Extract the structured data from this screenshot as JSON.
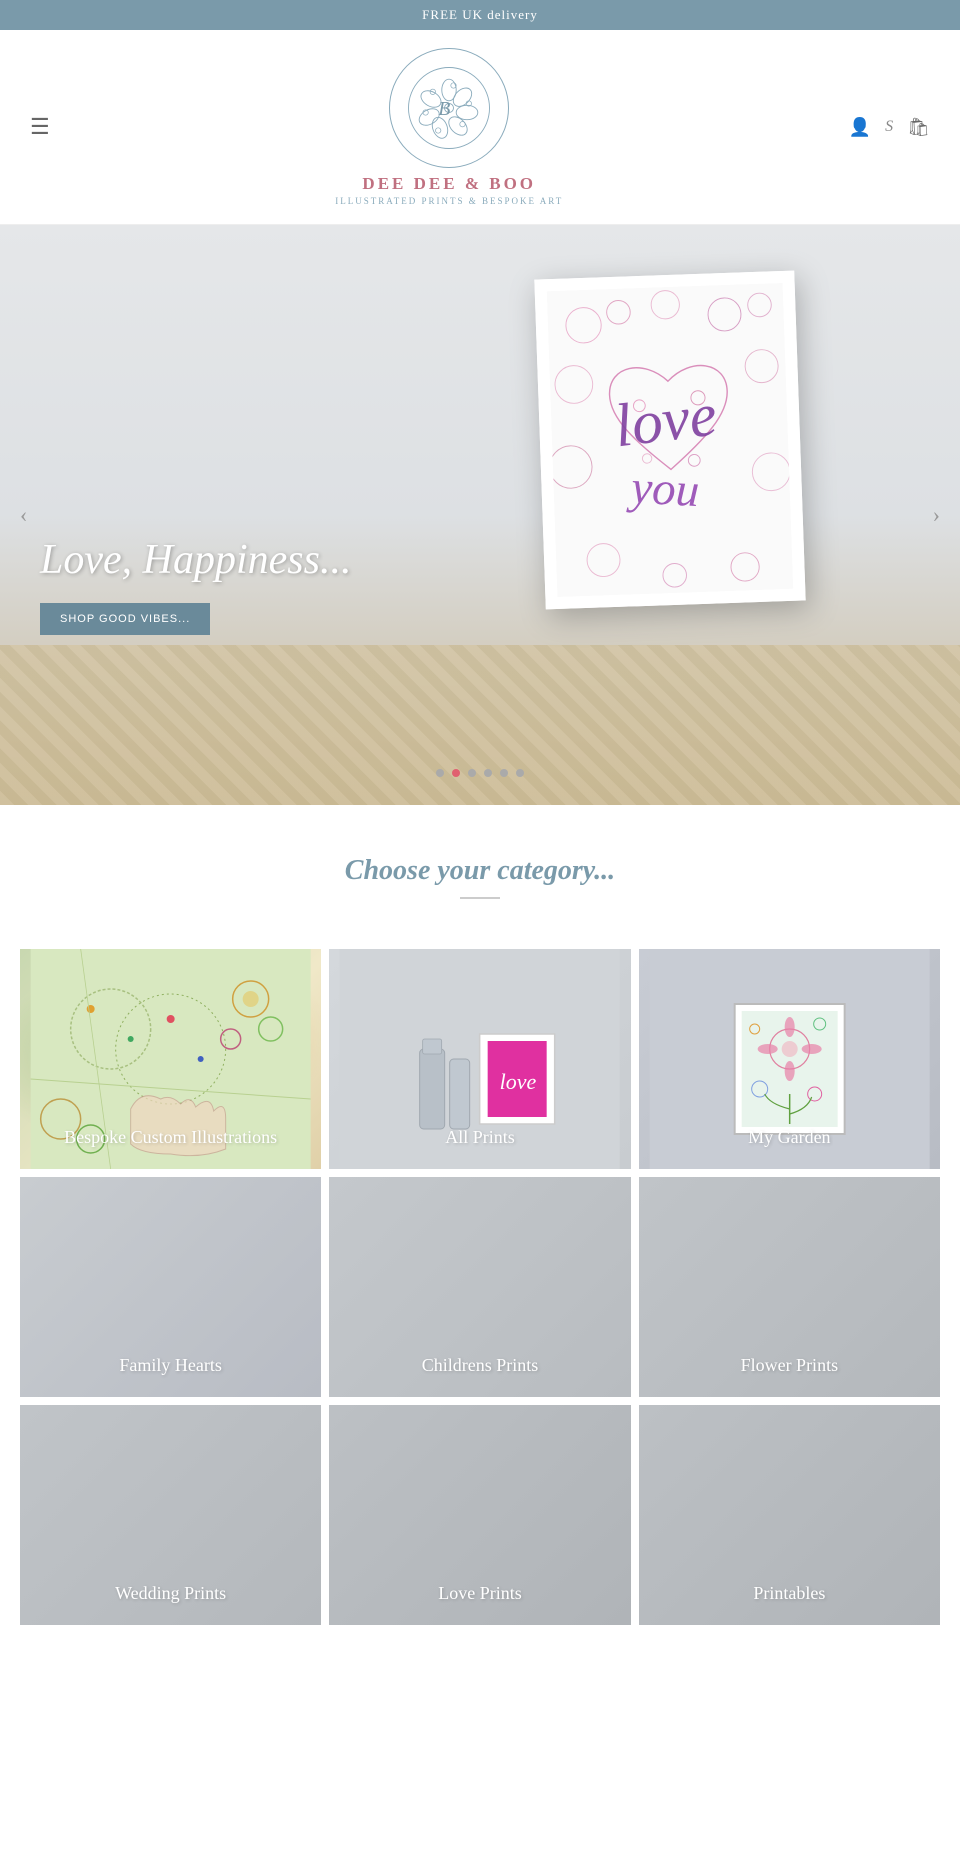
{
  "topbar": {
    "delivery_text": "FREE UK delivery"
  },
  "header": {
    "brand_name": "DEE DEE & BOO",
    "brand_subtitle": "ILLUSTRATED PRINTS & BESPOKE ART",
    "hamburger_label": "☰",
    "icons": {
      "user": "👤",
      "search": "S",
      "bag": "🛍"
    }
  },
  "hero": {
    "tagline": "Love, Happiness...",
    "cta_label": "SHOP GOOD VIBES...",
    "dots": [
      1,
      2,
      3,
      4,
      5,
      6
    ],
    "active_dot": 1
  },
  "categories": {
    "title": "Choose your category...",
    "items": [
      {
        "id": "bespoke",
        "label": "Bespoke Custom Illustrations",
        "style": "item-bespoke"
      },
      {
        "id": "allprints",
        "label": "All Prints",
        "style": "item-allprints"
      },
      {
        "id": "mygarden",
        "label": "My Garden",
        "style": "item-mygarden"
      },
      {
        "id": "familyhearts",
        "label": "Family Hearts",
        "style": "item-familyhearts"
      },
      {
        "id": "childrens",
        "label": "Childrens Prints",
        "style": "item-childrens"
      },
      {
        "id": "flower",
        "label": "Flower Prints",
        "style": "item-flower"
      },
      {
        "id": "wedding",
        "label": "Wedding Prints",
        "style": "item-wedding"
      },
      {
        "id": "love",
        "label": "Love Prints",
        "style": "item-love"
      },
      {
        "id": "printables",
        "label": "Printables",
        "style": "item-printables"
      }
    ]
  }
}
